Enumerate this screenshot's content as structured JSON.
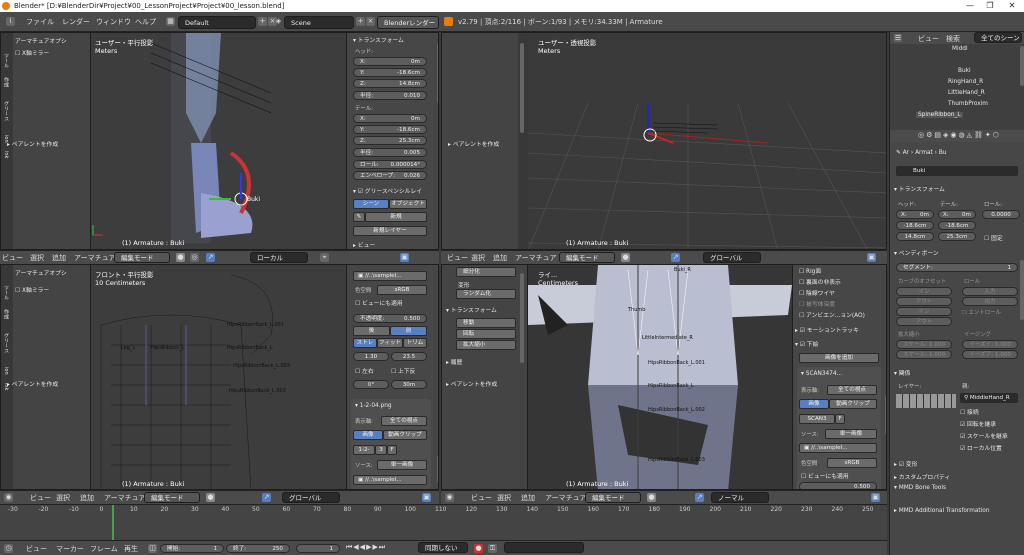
{
  "window": {
    "title": "Blender* [D:¥BlenderDir¥Project¥00_LessonProject¥Project¥00_lesson.blend]",
    "controls": [
      "—",
      "❐",
      "✕"
    ]
  },
  "menu": {
    "items": [
      "ファイル",
      "レンダー",
      "ウィンドウ",
      "ヘルプ"
    ],
    "layout": "Default",
    "scene": "Scene",
    "engine": "Blenderレンダー",
    "stats": "v2.79 | 頂点:2/116 | ボーン:1/93 | メモリ:34.33M | Armature"
  },
  "vp_tl": {
    "tool_header": "アーマチュアオプシ",
    "xmirror": "X軸ミラー",
    "parent": "ペアレントを作成",
    "view": "ユーザー・平行投影",
    "units": "Meters",
    "status": "(1) Armature : Buki",
    "bone_label": "Buki",
    "tabs": [
      "ツール",
      "作成",
      "グリース",
      "ion",
      "ink"
    ],
    "npanel": {
      "transform": "トランスフォーム",
      "head": "ヘッド:",
      "tail": "テール:",
      "head_x": {
        "k": "X:",
        "v": "0m"
      },
      "head_y": {
        "k": "Y:",
        "v": "-18.6cm"
      },
      "head_z": {
        "k": "Z:",
        "v": "14.8cm"
      },
      "radius1": {
        "k": "半径:",
        "v": "0.010"
      },
      "tail_x": {
        "k": "X:",
        "v": "0m"
      },
      "tail_y": {
        "k": "Y:",
        "v": "-18.6cm"
      },
      "tail_z": {
        "k": "Z:",
        "v": "25.3cm"
      },
      "radius2": {
        "k": "半径:",
        "v": "0.005"
      },
      "roll": {
        "k": "ロール:",
        "v": "0.000014°"
      },
      "envelope": {
        "k": "エンベロープ:",
        "v": "0.026"
      },
      "grease": "グリースペンシルレイ",
      "scene_btn": "シーン",
      "object_btn": "オブジェクト",
      "new": "新規",
      "new_layer": "新規レイヤー",
      "more": "ビュー"
    }
  },
  "vp_tr": {
    "info": "v2.79 | 頂点:2/116 | ボーン:1/93 | メモリ:34.33M | Armature",
    "view": "ユーザー・透視投影",
    "units": "Meters",
    "status": "(1) Armature : Buki",
    "parent": "ペアレントを作成"
  },
  "hdr_mid": {
    "items": [
      "ビュー",
      "選択",
      "追加",
      "アーマチュア"
    ],
    "mode": "編集モード",
    "orient": "ローカル"
  },
  "hdr_mid_r": {
    "items": [
      "ビュー",
      "選択",
      "追加",
      "アーマチュア"
    ],
    "mode": "編集モード",
    "orient": "グローバル"
  },
  "vp_bl": {
    "tool_header": "アーマチュアオプシ",
    "xmirror": "X軸ミラー",
    "parent": "ペアレントを作成",
    "view": "フロント・平行投影",
    "units": "10 Centimeters",
    "status": "(1) Armature : Buki",
    "tabs": [
      "ツール",
      "作成",
      "グリース",
      "ion",
      "ink"
    ],
    "bones": [
      "HipsRibbonBack_L.001",
      "HipsRibbonBack_L.003",
      "HipsRibbonBack_L.002",
      "HipsRibbonBack_L",
      "Leg_L",
      "HipsRibbon_L"
    ],
    "np": {
      "path": "//..\\sampleI...",
      "colorspace_k": "色空間",
      "colorspace": "sRGB",
      "view_as": "ビューにも適用",
      "alpha_k": "不透明度:",
      "alpha": "0.500",
      "front": "後",
      "back": "前",
      "fit": [
        "ストレ",
        "フィット",
        "トリム"
      ],
      "x": "1.30",
      "y": "23.5",
      "lr": "左右",
      "ud": "上下反",
      "rot": "0°",
      "depth": "30m",
      "img": "1-2-04.png",
      "axis_k": "表示軸:",
      "axis": "全ての視点",
      "src_k": "ソース:",
      "src": "単一画像",
      "image_btn": "画像",
      "clip_btn": "動画クリップ",
      "name": "1-2-",
      "frames": "3",
      "f": "F",
      "path2": "//..\\sampleI..."
    }
  },
  "vp_br": {
    "view": "ライ...",
    "units": "Centimeters",
    "status": "(1) Armature : Buki",
    "parent": "ペアレントを作成",
    "tool_items": [
      "細分化",
      "変形",
      "ランダム化",
      "トランスフォーム",
      "移動",
      "回転",
      "拡大縮小",
      "履歴"
    ],
    "bones": [
      "LittleIntermediate_R",
      "HipsRibbonBack_L.001",
      "HipsRibbonBack_L.002",
      "HipsRibbonBack_L.003",
      "HipsRibbonBack_L",
      "Thumb",
      "Buki_R"
    ],
    "np": {
      "items": [
        "Rig面",
        "裏面の非表示",
        "陰線ワイヤ",
        "被写体深度",
        "アンビエン...ョン(AO)"
      ],
      "motion": "モーショントラッキ",
      "bg": "下絵",
      "add_image": "画像を追加",
      "scan": "SCAN3474...",
      "axis_k": "表示軸:",
      "axis": "全ての視点",
      "image_btn": "画像",
      "clip_btn": "動画クリップ",
      "img_name": "SCAN3",
      "f": "F",
      "src_k": "ソース:",
      "src": "単一画像",
      "path": "//..\\sampleI...",
      "cs_k": "色空間",
      "cs": "sRGB",
      "view_as": "ビューにも適用",
      "alpha": "0.500"
    }
  },
  "hdr_bot": {
    "items": [
      "ビュー",
      "選択",
      "追加",
      "アーマチュア"
    ],
    "mode": "編集モード",
    "orient": "グローバル"
  },
  "hdr_bot_r": {
    "items": [
      "ビュー",
      "選択",
      "追加",
      "アーマチュア"
    ],
    "mode": "編集モード",
    "orient": "ノーマル"
  },
  "timeline": {
    "ticks": [
      "-30",
      "-20",
      "-10",
      "0",
      "10",
      "20",
      "30",
      "40",
      "50",
      "60",
      "70",
      "80",
      "90",
      "100",
      "110",
      "120",
      "130",
      "140",
      "150",
      "160",
      "170",
      "180",
      "190",
      "200",
      "210",
      "220",
      "230",
      "240",
      "250"
    ],
    "items": [
      "ビュー",
      "マーカー",
      "フレーム",
      "再生"
    ],
    "start_k": "開始:",
    "start": "1",
    "end_k": "終了:",
    "end": "250",
    "current": "1",
    "sync": "同期しない"
  },
  "outliner": {
    "view": "ビュー",
    "search": "検索",
    "scenes": "全てのシーン",
    "rows": [
      "Middl",
      "Buki",
      "RingHand_R",
      "LittleHand_R",
      "ThumbProxim",
      "SpineRibbon_L"
    ]
  },
  "props": {
    "breadcrumb": [
      "Ar",
      "Armat",
      "Bu"
    ],
    "bone_name": "Buki",
    "transform": "トランスフォーム",
    "head": "ヘッド:",
    "tail": "テール:",
    "roll": "ロール:",
    "hx": "X:",
    "hxv": "0m",
    "tx": "X:",
    "txv": "0m",
    "rollv": "0.0000",
    "hy": "-18.6cm",
    "ty": "-18.6cm",
    "hz": "14.8cm",
    "tz": "25.3cm",
    "lock": "固定",
    "bendy": "ベンディボーン",
    "seg": "セグメント:",
    "segv": "1",
    "curve_in": "カーブのオフセット",
    "roll_h": "ロール",
    "g": [
      "イン",
      "アウト",
      "イン",
      "アウト"
    ],
    "g2": [
      "入力",
      "出力",
      "エントロール"
    ],
    "scale": "拡大縮小",
    "ease": "イージング",
    "sc_in": "スケール: 1.000",
    "sc_out": "スケール: 1.000",
    "ease_in": "イーズイ: 1.000",
    "ease_out": "イーズア: 1.000",
    "rel": "関係",
    "layers": "レイヤー:",
    "parent": "親:",
    "parent_v": "MiddleHand_R",
    "conn": "接続",
    "inherit_rot": "回転を継承",
    "inherit_scale": "スケールを継承",
    "local": "ローカル位置",
    "deform": "変形",
    "custom": "カスタムプロパティ",
    "mmd": "MMD Bone Tools",
    "mmd2": "MMD Additional Transformation"
  }
}
